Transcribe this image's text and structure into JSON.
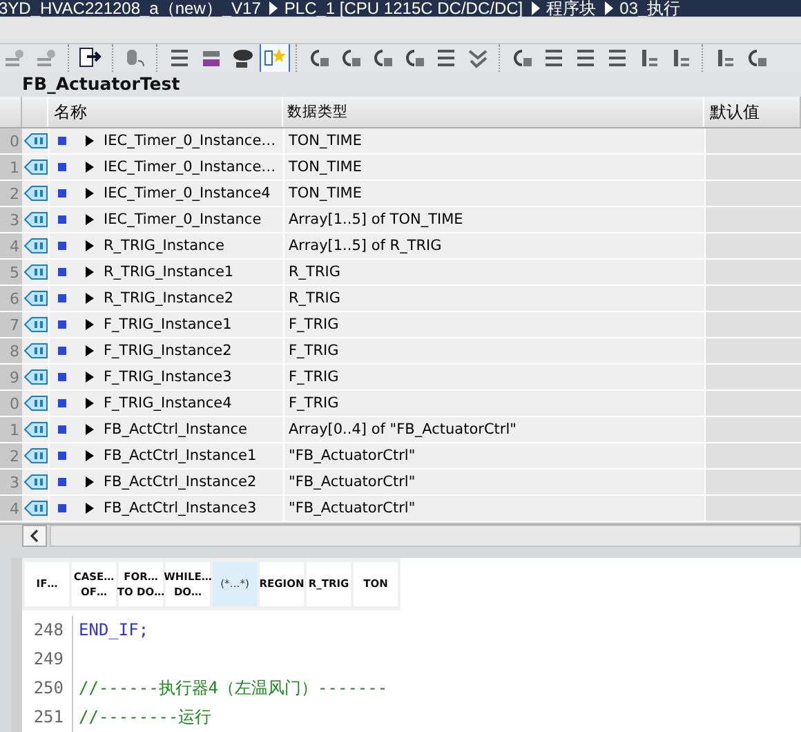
{
  "breadcrumb": [
    "3YD_HVAC221208_a（new）_V17",
    "PLC_1 [CPU 1215C DC/DC/DC]",
    "程序块",
    "03_执行"
  ],
  "toolbar": [
    {
      "selected": false
    },
    {
      "selected": false
    },
    {
      "selected": false
    },
    {
      "selected": false
    },
    {
      "selected": false
    },
    {
      "selected": false
    },
    {
      "selected": false
    },
    {
      "selected": true
    },
    {
      "selected": false
    },
    {
      "selected": false
    },
    {
      "selected": false
    },
    {
      "selected": false
    },
    {
      "selected": false
    },
    {
      "selected": false
    },
    {
      "selected": false
    },
    {
      "selected": false
    },
    {
      "selected": false
    },
    {
      "selected": false
    },
    {
      "selected": false
    },
    {
      "selected": false
    },
    {
      "selected": false
    },
    {
      "selected": false
    }
  ],
  "block_title": "FB_ActuatorTest",
  "table": {
    "columns": [
      "名称",
      "数据类型",
      "默认值"
    ],
    "rows": [
      {
        "row_number": "0",
        "name": "IEC_Timer_0_Instance…",
        "data_type": "TON_TIME",
        "expanded": false
      },
      {
        "row_number": "1",
        "name": "IEC_Timer_0_Instance…",
        "data_type": "TON_TIME",
        "expanded": false
      },
      {
        "row_number": "2",
        "name": "IEC_Timer_0_Instance4",
        "data_type": "TON_TIME",
        "expanded": false
      },
      {
        "row_number": "3",
        "name": "IEC_Timer_0_Instance",
        "data_type": "Array[1..5] of TON_TIME",
        "expanded": false
      },
      {
        "row_number": "4",
        "name": "R_TRIG_Instance",
        "data_type": "Array[1..5] of R_TRIG",
        "expanded": false
      },
      {
        "row_number": "5",
        "name": "R_TRIG_Instance1",
        "data_type": "R_TRIG",
        "expanded": false
      },
      {
        "row_number": "6",
        "name": "R_TRIG_Instance2",
        "data_type": "R_TRIG",
        "expanded": false
      },
      {
        "row_number": "7",
        "name": "F_TRIG_Instance1",
        "data_type": "F_TRIG",
        "expanded": false
      },
      {
        "row_number": "8",
        "name": "F_TRIG_Instance2",
        "data_type": "F_TRIG",
        "expanded": false
      },
      {
        "row_number": "9",
        "name": "F_TRIG_Instance3",
        "data_type": "F_TRIG",
        "expanded": false
      },
      {
        "row_number": "0",
        "name": "F_TRIG_Instance4",
        "data_type": "F_TRIG",
        "expanded": false
      },
      {
        "row_number": "1",
        "name": "FB_ActCtrl_Instance",
        "data_type": "Array[0..4] of \"FB_ActuatorCtrl\"",
        "expanded": false
      },
      {
        "row_number": "2",
        "name": "FB_ActCtrl_Instance1",
        "data_type": "\"FB_ActuatorCtrl\"",
        "expanded": false
      },
      {
        "row_number": "3",
        "name": "FB_ActCtrl_Instance2",
        "data_type": "\"FB_ActuatorCtrl\"",
        "expanded": false
      },
      {
        "row_number": "4",
        "name": "FB_ActCtrl_Instance3",
        "data_type": "\"FB_ActuatorCtrl\"",
        "expanded": false
      }
    ]
  },
  "snippets": [
    {
      "lines": [
        "IF…"
      ],
      "selected": false
    },
    {
      "lines": [
        "CASE…",
        "OF…"
      ],
      "selected": false
    },
    {
      "lines": [
        "FOR…",
        "TO DO…"
      ],
      "selected": false
    },
    {
      "lines": [
        "WHILE…",
        "DO…"
      ],
      "selected": false
    },
    {
      "lines": [
        "(*…*)"
      ],
      "selected": true
    },
    {
      "lines": [
        "REGION"
      ],
      "selected": false
    },
    {
      "lines": [
        "R_TRIG"
      ],
      "selected": false
    },
    {
      "lines": [
        "TON"
      ],
      "selected": false
    }
  ],
  "code": [
    {
      "number": "248",
      "kind": "keyword",
      "text": "END_IF;"
    },
    {
      "number": "249"
    },
    {
      "number": "250",
      "kind": "comment",
      "text": "//------执行器4（左温风门）-------"
    },
    {
      "number": "251",
      "kind": "comment",
      "text": "//--------运行"
    }
  ]
}
